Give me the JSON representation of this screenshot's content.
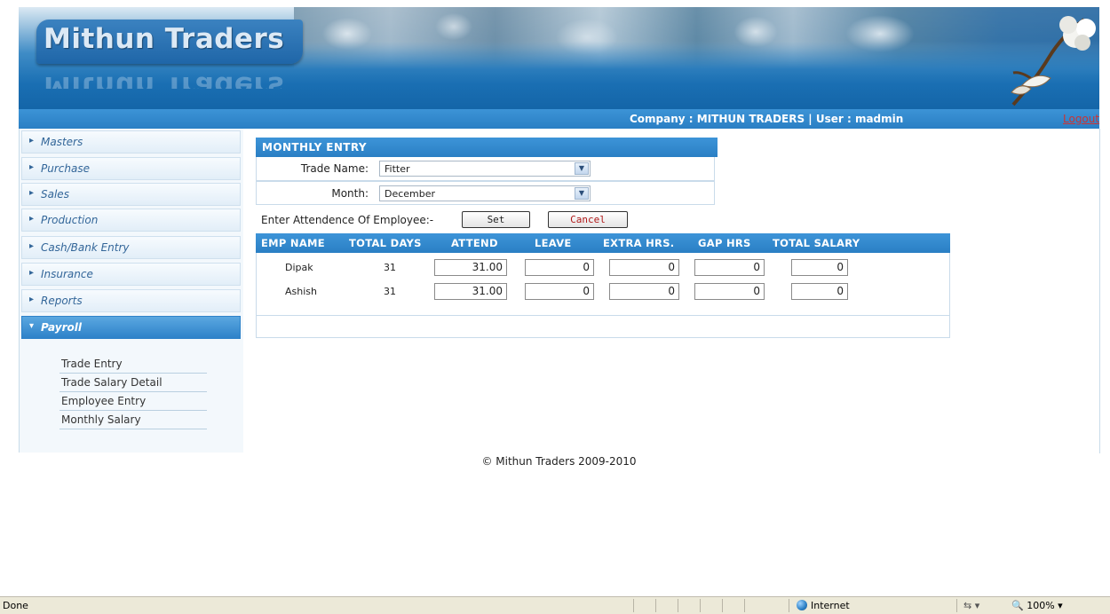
{
  "brand": {
    "name": "Mithun Traders"
  },
  "header": {
    "company_label": "Company : MITHUN TRADERS |  User : madmin",
    "logout": "Logout"
  },
  "sidebar": {
    "items": [
      {
        "label": "Masters",
        "active": false
      },
      {
        "label": "Purchase",
        "active": false
      },
      {
        "label": "Sales",
        "active": false
      },
      {
        "label": "Production",
        "active": false
      },
      {
        "label": "Cash/Bank Entry",
        "active": false
      },
      {
        "label": "Insurance",
        "active": false
      },
      {
        "label": "Reports",
        "active": false
      },
      {
        "label": "Payroll",
        "active": true
      }
    ],
    "submenu": [
      "Trade Entry",
      "Trade Salary Detail",
      "Employee Entry",
      "Monthly Salary"
    ]
  },
  "form": {
    "title": "MONTHLY ENTRY",
    "trade_label": "Trade Name:",
    "trade_value": "Fitter",
    "month_label": "Month:",
    "month_value": "December",
    "attend_label": "Enter Attendence Of Employee:-",
    "set_label": "Set",
    "cancel_label": "Cancel"
  },
  "grid": {
    "headers": [
      "EMP NAME",
      "TOTAL DAYS",
      "ATTEND",
      "LEAVE",
      "EXTRA HRS.",
      "GAP HRS",
      "TOTAL SALARY"
    ],
    "rows": [
      {
        "name": "Dipak",
        "days": "31",
        "attend": "31.00",
        "leave": "0",
        "extra": "0",
        "gap": "0",
        "salary": "0"
      },
      {
        "name": "Ashish",
        "days": "31",
        "attend": "31.00",
        "leave": "0",
        "extra": "0",
        "gap": "0",
        "salary": "0"
      }
    ]
  },
  "footer": {
    "copyright": "© Mithun Traders 2009-2010"
  },
  "statusbar": {
    "status": "Done",
    "zone": "Internet",
    "zoom": "100%"
  }
}
